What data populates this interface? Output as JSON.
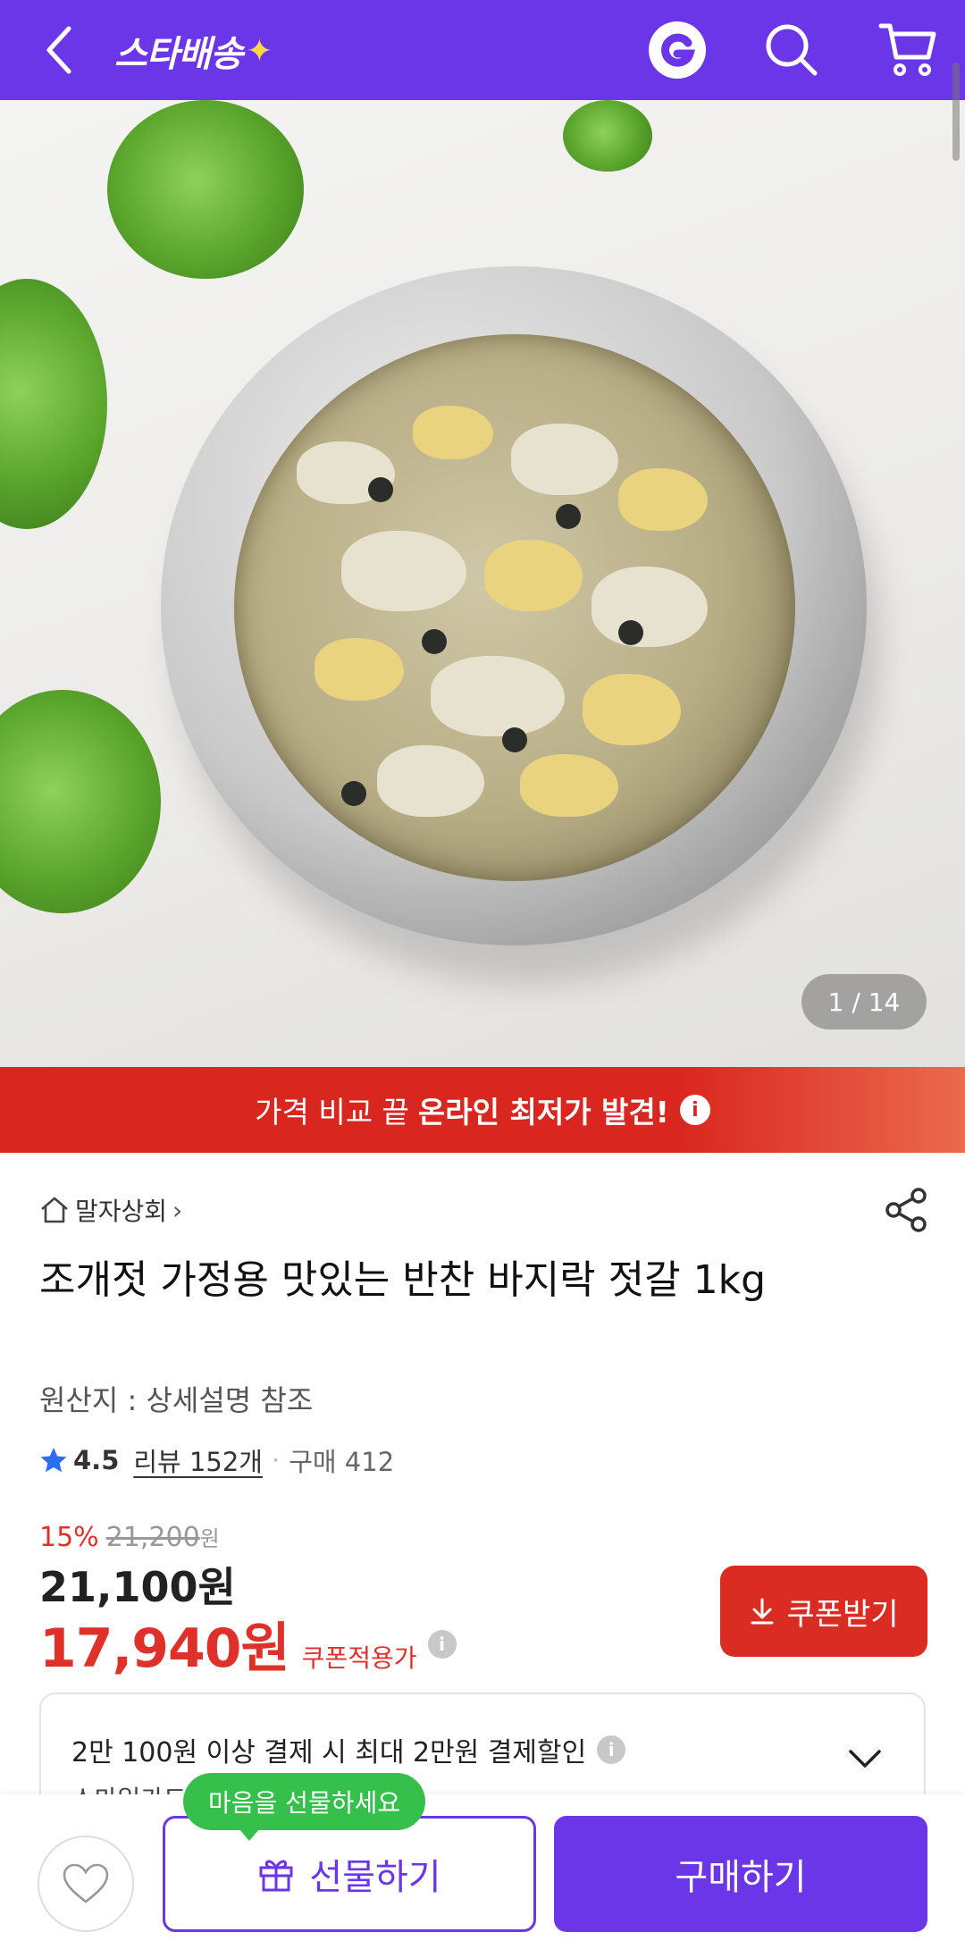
{
  "header": {
    "brand": "스타배송",
    "brand_spark": "✦",
    "back_icon": "chevron-left-icon",
    "icons": [
      "g-logo-icon",
      "search-icon",
      "cart-icon"
    ]
  },
  "gallery": {
    "pager": "1 / 14",
    "current": 1,
    "total": 14
  },
  "promo": {
    "text": "가격 비교 끝",
    "bold": "온라인 최저가 발견!",
    "info": "i"
  },
  "store": {
    "name": "말자상회",
    "chevron": "›"
  },
  "product": {
    "title": "조개젓 가정용 맛있는 반찬 바지락 젓갈 1kg",
    "origin": "원산지 : 상세설명 참조",
    "rating": "4.5",
    "reviews": "리뷰 152개",
    "sold": "구매 412"
  },
  "price": {
    "discount_pct": "15%",
    "original": "21,200",
    "original_unit": "원",
    "sale": "21,100원",
    "coupon_price": "17,940원",
    "coupon_label": "쿠폰적용가",
    "info": "i"
  },
  "coupon_button": {
    "label": "쿠폰받기"
  },
  "benefit": {
    "text": "2만 100원 이상 결제 시 최대 2만원 결제할인",
    "sub": "스마일카드",
    "info": "i"
  },
  "bottom": {
    "gift_tooltip": "마음을 선물하세요",
    "gift": "선물하기",
    "buy": "구매하기"
  },
  "colors": {
    "brand": "#6b35e8",
    "promo_red": "#d9261e",
    "price_red": "#e0302a",
    "tooltip_green": "#35c04c"
  }
}
